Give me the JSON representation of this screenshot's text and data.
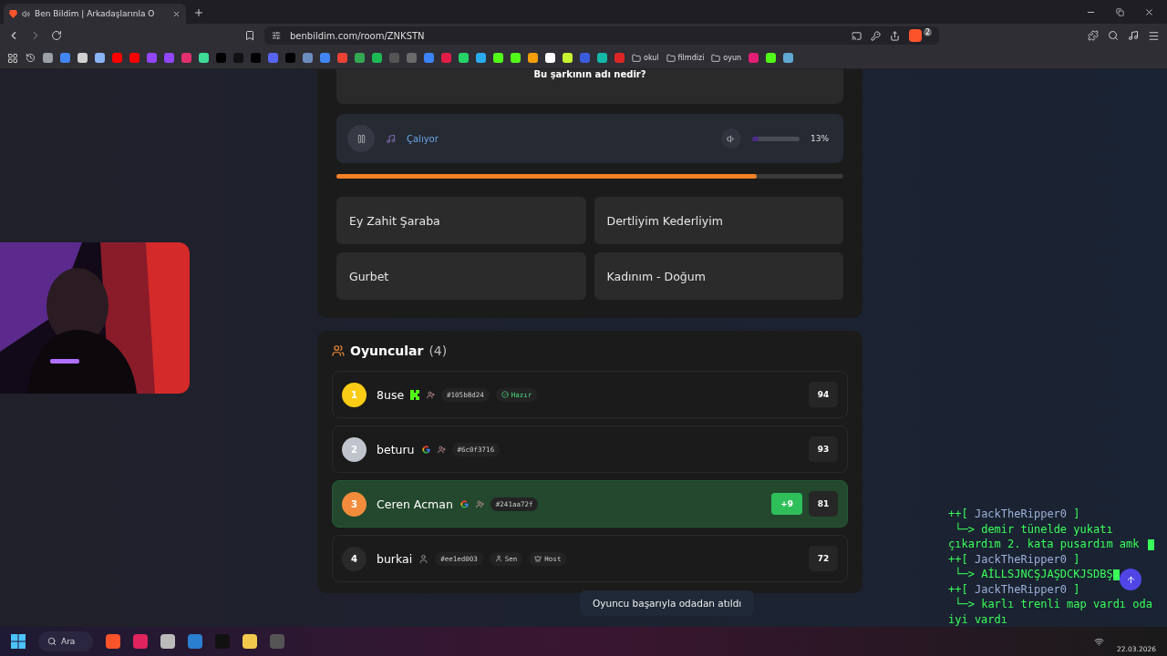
{
  "browser": {
    "tab": {
      "title": "Ben Bildim | Arkadaşlarınla O",
      "audio": true
    },
    "url": "benbildim.com/room/ZNKSTN",
    "shield_count": "2",
    "bookmarks": [
      {
        "kind": "icon",
        "color": "#9aa0a6"
      },
      {
        "kind": "icon",
        "color": "#4285f4"
      },
      {
        "kind": "icon",
        "color": "#d0d0d0"
      },
      {
        "kind": "icon",
        "color": "#8ab4f8"
      },
      {
        "kind": "icon",
        "color": "#ff0000"
      },
      {
        "kind": "icon",
        "color": "#ff0000"
      },
      {
        "kind": "icon",
        "color": "#9146ff"
      },
      {
        "kind": "icon",
        "color": "#9146ff"
      },
      {
        "kind": "icon",
        "color": "#e1306c"
      },
      {
        "kind": "icon",
        "color": "#3ddc97"
      },
      {
        "kind": "icon",
        "color": "#000000"
      },
      {
        "kind": "icon",
        "color": "#111111"
      },
      {
        "kind": "icon",
        "color": "#000000"
      },
      {
        "kind": "icon",
        "color": "#5865f2"
      },
      {
        "kind": "icon",
        "color": "#000000"
      },
      {
        "kind": "icon",
        "color": "#6c8ebf"
      },
      {
        "kind": "icon",
        "color": "#4285f4"
      },
      {
        "kind": "icon",
        "color": "#ea4335"
      },
      {
        "kind": "icon",
        "color": "#34a853"
      },
      {
        "kind": "icon",
        "color": "#1db954"
      },
      {
        "kind": "icon",
        "color": "#555555"
      },
      {
        "kind": "icon",
        "color": "#6b6b6b"
      },
      {
        "kind": "icon",
        "color": "#3b82f6"
      },
      {
        "kind": "icon",
        "color": "#e11d48"
      },
      {
        "kind": "icon",
        "color": "#25d366"
      },
      {
        "kind": "icon",
        "color": "#2aabee"
      },
      {
        "kind": "icon",
        "color": "#53fc18"
      },
      {
        "kind": "icon",
        "color": "#53fc18"
      },
      {
        "kind": "icon",
        "color": "#f59e0b"
      },
      {
        "kind": "icon",
        "color": "#ffffff"
      },
      {
        "kind": "icon",
        "color": "#c6f432"
      },
      {
        "kind": "icon",
        "color": "#3b5bdb"
      },
      {
        "kind": "icon",
        "color": "#14b8a6"
      },
      {
        "kind": "icon",
        "color": "#dc2626"
      },
      {
        "kind": "folder",
        "label": "okul"
      },
      {
        "kind": "folder",
        "label": "filmdizi"
      },
      {
        "kind": "folder",
        "label": "oyun"
      },
      {
        "kind": "icon",
        "color": "#e11d74"
      },
      {
        "kind": "icon",
        "color": "#53fc18"
      },
      {
        "kind": "icon",
        "color": "#5fa8d3"
      }
    ]
  },
  "question": {
    "text": "Bu şarkının adı nedir?"
  },
  "player": {
    "playing": true,
    "status": "Çalıyor",
    "volume": {
      "level": 0.13,
      "reading": "13%"
    }
  },
  "timer": {
    "level": 0.83
  },
  "answers": [
    "Ey Zahit Şaraba",
    "Dertliyim Kederliyim",
    "Gurbet",
    "Kadınım - Doğum"
  ],
  "players_section": {
    "title": "Oyuncular",
    "count": "(4)",
    "players": [
      {
        "rank": "1",
        "color": "#facc15",
        "name": "8use",
        "kind": "kick",
        "id": "#105b8d24",
        "tags": [
          {
            "kind": "ready",
            "label": "Hazır"
          }
        ],
        "score": "94",
        "highlighted": false
      },
      {
        "rank": "2",
        "color": "#c0c4cc",
        "name": "beturu",
        "kind": "google",
        "id": "#6c0f3716",
        "score": "93",
        "highlighted": false
      },
      {
        "rank": "3",
        "color": "#f28c3c",
        "name": "Ceren Acman",
        "kind": "google",
        "id": "#241aa72f",
        "gain": "+9",
        "score": "81",
        "highlighted": true
      },
      {
        "rank": "4",
        "color": "#2a2a2a",
        "name": "burkai",
        "kind": "guest",
        "id": "#ee1ed003",
        "tags": [
          {
            "kind": "you",
            "label": "Sen"
          },
          {
            "kind": "host",
            "label": "Host"
          }
        ],
        "score": "72",
        "highlighted": false
      }
    ]
  },
  "toast": "Oyuncu başarıyla odadan atıldı",
  "chat_overlay": [
    {
      "kind": "user",
      "prefix": "++[",
      "text": "JackTheRipper0",
      "suffix": "]"
    },
    {
      "kind": "message",
      "prefix": "└─>",
      "text": "demir tünelde yukatı çıkardım 2. kata pusardım amk",
      "cursor": true
    },
    {
      "kind": "user",
      "prefix": "++[",
      "text": "JackTheRipper0",
      "suffix": "]"
    },
    {
      "kind": "message",
      "prefix": "└─>",
      "text": "AİLLSJNCŞJAŞDCKJSDBŞ",
      "cursor": true
    },
    {
      "kind": "user",
      "prefix": "++[",
      "text": "JackTheRipper0",
      "suffix": "]"
    },
    {
      "kind": "message",
      "prefix": "└─>",
      "text": "karlı trenli map vardı oda iyi vardı",
      "cursor": false
    }
  ],
  "taskbar": {
    "search": "Ara",
    "date": "22.03.2026"
  }
}
